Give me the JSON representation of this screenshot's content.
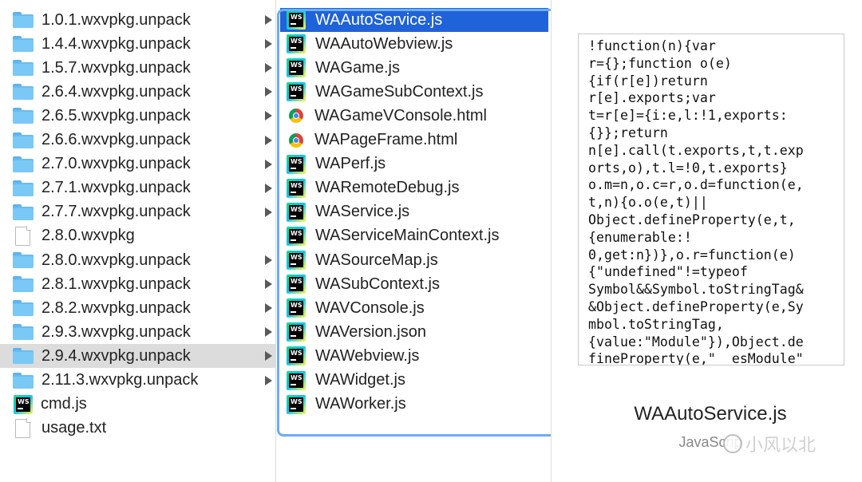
{
  "folders_column": {
    "items": [
      {
        "label": "1.0.1.wxvpkg.unpack",
        "icon": "folder-icon",
        "has_children": true
      },
      {
        "label": "1.4.4.wxvpkg.unpack",
        "icon": "folder-icon",
        "has_children": true
      },
      {
        "label": "1.5.7.wxvpkg.unpack",
        "icon": "folder-icon",
        "has_children": true
      },
      {
        "label": "2.6.4.wxvpkg.unpack",
        "icon": "folder-icon",
        "has_children": true
      },
      {
        "label": "2.6.5.wxvpkg.unpack",
        "icon": "folder-icon",
        "has_children": true
      },
      {
        "label": "2.6.6.wxvpkg.unpack",
        "icon": "folder-icon",
        "has_children": true
      },
      {
        "label": "2.7.0.wxvpkg.unpack",
        "icon": "folder-icon",
        "has_children": true
      },
      {
        "label": "2.7.1.wxvpkg.unpack",
        "icon": "folder-icon",
        "has_children": true
      },
      {
        "label": "2.7.7.wxvpkg.unpack",
        "icon": "folder-icon",
        "has_children": true
      },
      {
        "label": "2.8.0.wxvpkg",
        "icon": "document-icon",
        "has_children": false
      },
      {
        "label": "2.8.0.wxvpkg.unpack",
        "icon": "folder-icon",
        "has_children": true
      },
      {
        "label": "2.8.1.wxvpkg.unpack",
        "icon": "folder-icon",
        "has_children": true
      },
      {
        "label": "2.8.2.wxvpkg.unpack",
        "icon": "folder-icon",
        "has_children": true
      },
      {
        "label": "2.9.3.wxvpkg.unpack",
        "icon": "folder-icon",
        "has_children": true
      },
      {
        "label": "2.9.4.wxvpkg.unpack",
        "icon": "folder-icon",
        "has_children": true,
        "selected": true
      },
      {
        "label": "2.11.3.wxvpkg.unpack",
        "icon": "folder-icon",
        "has_children": true
      },
      {
        "label": "cmd.js",
        "icon": "webstorm-js-icon",
        "has_children": false
      },
      {
        "label": "usage.txt",
        "icon": "document-icon",
        "has_children": false
      }
    ]
  },
  "files_column": {
    "items": [
      {
        "label": "WAAutoService.js",
        "icon": "webstorm-js-icon",
        "selected": true
      },
      {
        "label": "WAAutoWebview.js",
        "icon": "webstorm-js-icon"
      },
      {
        "label": "WAGame.js",
        "icon": "webstorm-js-icon"
      },
      {
        "label": "WAGameSubContext.js",
        "icon": "webstorm-js-icon"
      },
      {
        "label": "WAGameVConsole.html",
        "icon": "chrome-html-icon"
      },
      {
        "label": "WAPageFrame.html",
        "icon": "chrome-html-icon"
      },
      {
        "label": "WAPerf.js",
        "icon": "webstorm-js-icon"
      },
      {
        "label": "WARemoteDebug.js",
        "icon": "webstorm-js-icon"
      },
      {
        "label": "WAService.js",
        "icon": "webstorm-js-icon"
      },
      {
        "label": "WAServiceMainContext.js",
        "icon": "webstorm-js-icon"
      },
      {
        "label": "WASourceMap.js",
        "icon": "webstorm-js-icon"
      },
      {
        "label": "WASubContext.js",
        "icon": "webstorm-js-icon"
      },
      {
        "label": "WAVConsole.js",
        "icon": "webstorm-js-icon"
      },
      {
        "label": "WAVersion.json",
        "icon": "webstorm-js-icon"
      },
      {
        "label": "WAWebview.js",
        "icon": "webstorm-js-icon"
      },
      {
        "label": "WAWidget.js",
        "icon": "webstorm-js-icon"
      },
      {
        "label": "WAWorker.js",
        "icon": "webstorm-js-icon"
      }
    ]
  },
  "preview": {
    "code_lines": [
      "!function(n){var",
      "r={};function o(e)",
      "{if(r[e])return",
      "r[e].exports;var",
      "t=r[e]={i:e,l:!1,exports:",
      "{}};return",
      "n[e].call(t.exports,t,t.exp",
      "orts,o),t.l=!0,t.exports}",
      "o.m=n,o.c=r,o.d=function(e,",
      "t,n){o.o(e,t)||",
      "Object.defineProperty(e,t,",
      "{enumerable:!",
      "0,get:n})},o.r=function(e)",
      "{\"undefined\"!=typeof",
      "Symbol&&Symbol.toStringTag&",
      "&Object.defineProperty(e,Sy",
      "mbol.toStringTag,",
      "{value:\"Module\"}),Object.de",
      "fineProperty(e,\"__esModule\""
    ],
    "file_name": "WAAutoService.js",
    "file_type": "JavaScrip",
    "watermark": "小风以北"
  },
  "colors": {
    "selection_active": "#1f62d9",
    "selection_inactive": "#dcdcdc",
    "focus_ring": "#6aaef0",
    "folder": "#7ac8f5"
  }
}
